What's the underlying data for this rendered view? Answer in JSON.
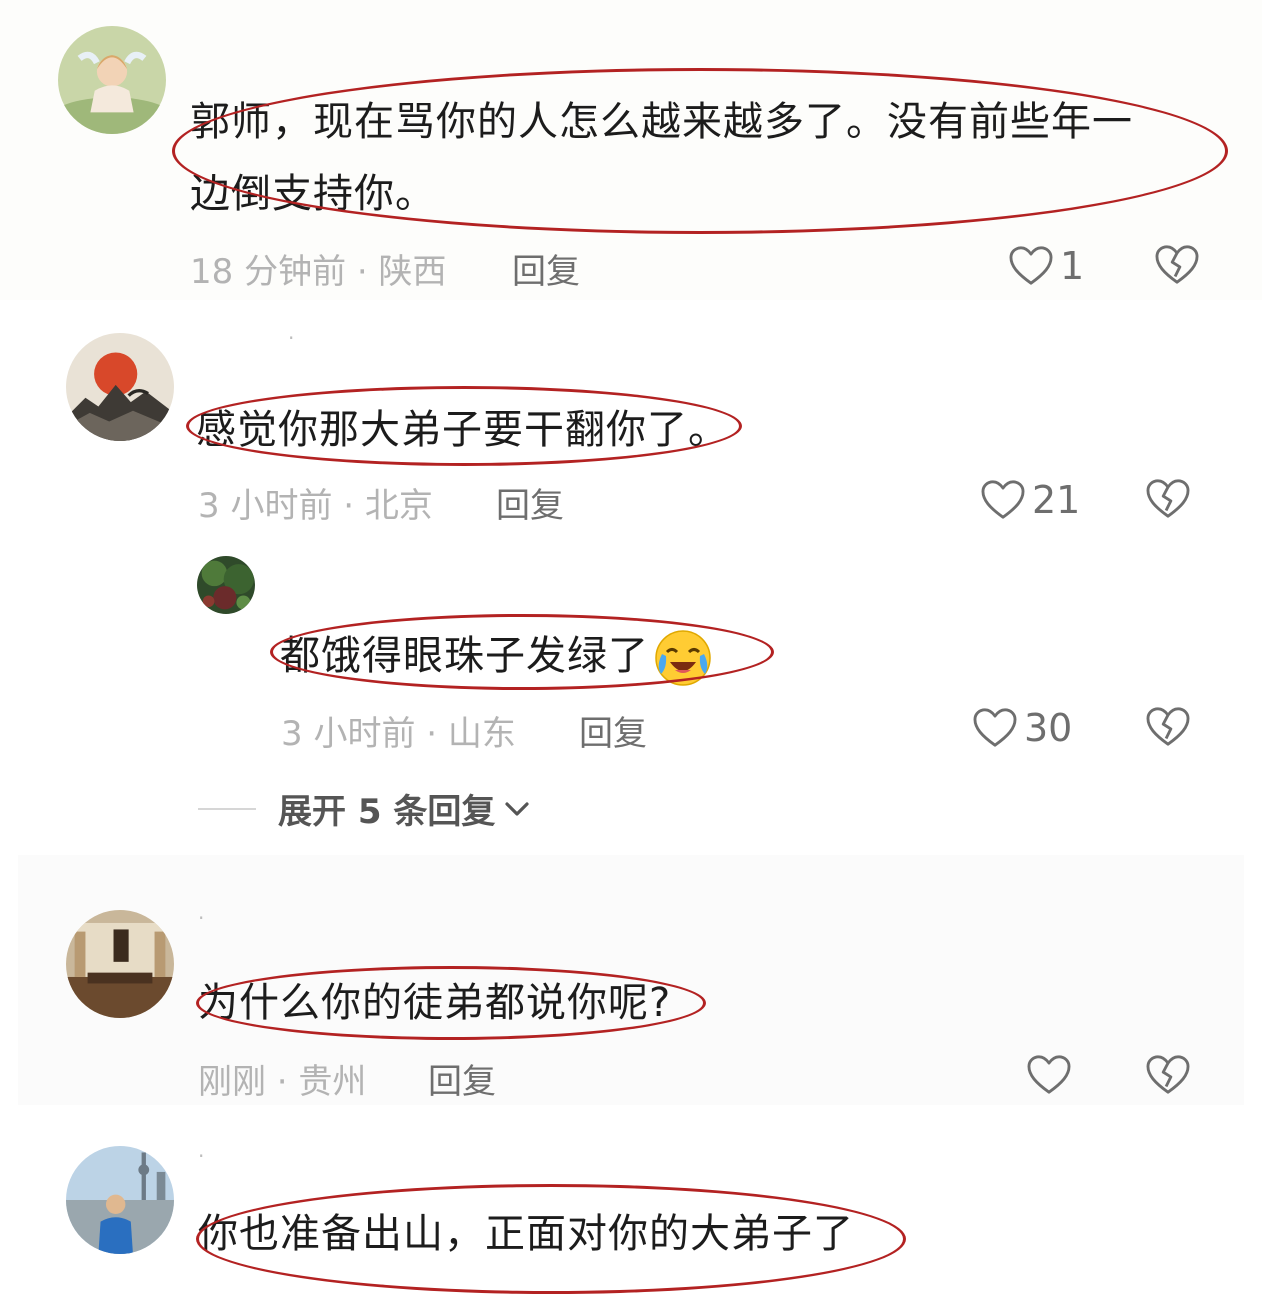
{
  "comments": [
    {
      "text_line1": "郭师，现在骂你的人怎么越来越多了。没有前些年一",
      "text_line2": "边倒支持你。",
      "time": "18 分钟前 · 陕西",
      "reply": "回复",
      "likes": "1"
    },
    {
      "text": "感觉你那大弟子要干翻你了。",
      "time": "3 小时前 · 北京",
      "reply": "回复",
      "likes": "21"
    },
    {
      "text": "为什么你的徒弟都说你呢?",
      "time": "刚刚 · 贵州",
      "reply": "回复",
      "likes": ""
    },
    {
      "text": "你也准备出山，正面对你的大弟子了"
    }
  ],
  "sub_reply": {
    "text": "都饿得眼珠子发绿了",
    "emoji": "crying-laughing-emoji",
    "time": "3 小时前 · 山东",
    "reply": "回复",
    "likes": "30"
  },
  "expand": {
    "label": "展开 5 条回复"
  },
  "colors": {
    "highlight_oval": "#b32222",
    "meta_text": "#b3b3b3",
    "icon_gray": "#6e6e6e"
  }
}
